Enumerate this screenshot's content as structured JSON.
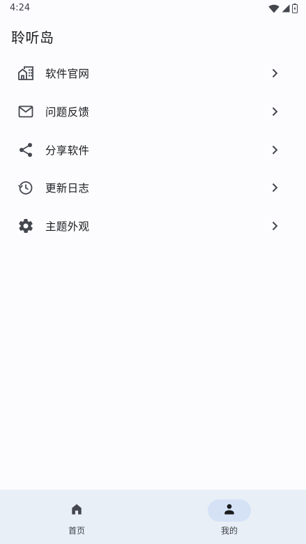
{
  "status_bar": {
    "time": "4:24"
  },
  "app_bar": {
    "title": "聆听岛"
  },
  "menu": {
    "items": [
      {
        "label": "软件官网",
        "icon": "home-work-icon"
      },
      {
        "label": "问题反馈",
        "icon": "mail-icon"
      },
      {
        "label": "分享软件",
        "icon": "share-icon"
      },
      {
        "label": "更新日志",
        "icon": "history-icon"
      },
      {
        "label": "主题外观",
        "icon": "settings-icon"
      }
    ]
  },
  "bottom_nav": {
    "items": [
      {
        "label": "首页",
        "icon": "home-icon",
        "selected": false
      },
      {
        "label": "我的",
        "icon": "person-icon",
        "selected": true
      }
    ]
  },
  "colors": {
    "background": "#fcfcff",
    "nav_background": "#e9eff6",
    "nav_indicator": "#d5e2f6",
    "icon": "#44474e"
  }
}
